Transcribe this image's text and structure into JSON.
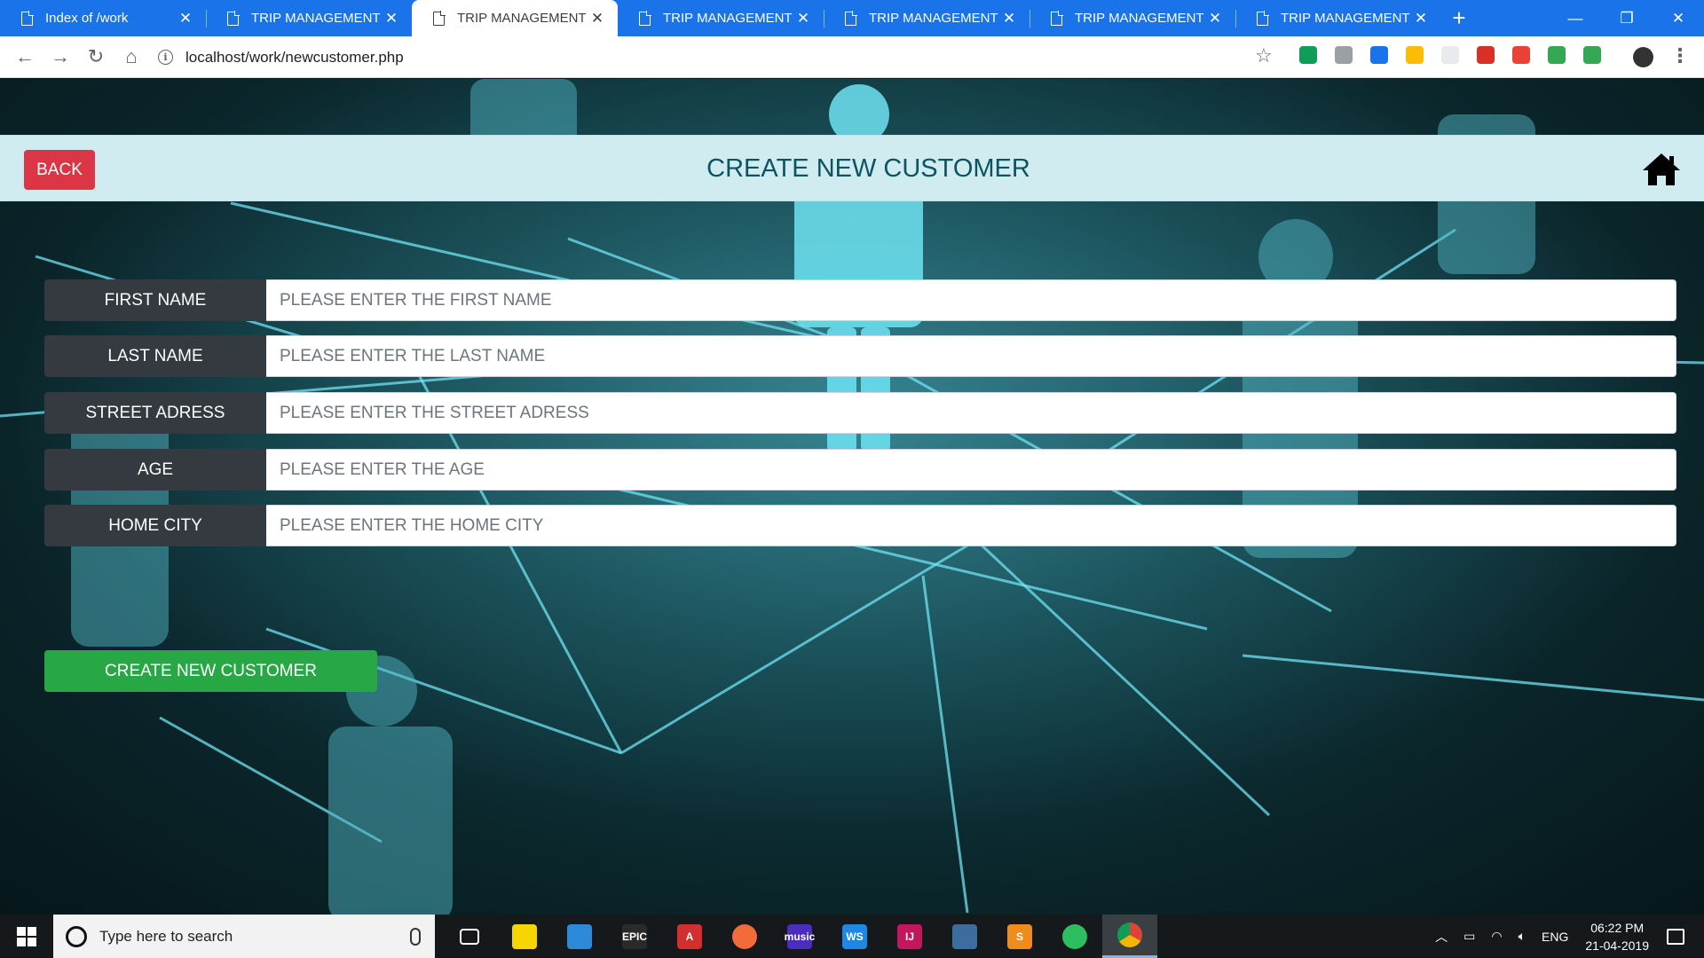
{
  "browser": {
    "tabs": [
      {
        "title": "Index of /work",
        "active": false
      },
      {
        "title": "TRIP MANAGEMENT",
        "active": false
      },
      {
        "title": "TRIP MANAGEMENT",
        "active": true
      },
      {
        "title": "TRIP MANAGEMENT",
        "active": false
      },
      {
        "title": "TRIP MANAGEMENT",
        "active": false
      },
      {
        "title": "TRIP MANAGEMENT",
        "active": false
      },
      {
        "title": "TRIP MANAGEMENT",
        "active": false
      }
    ],
    "url": "localhost/work/newcustomer.php",
    "extensions": [
      "#0f9d58",
      "#9aa0a6",
      "#1a73e8",
      "#fbbc04",
      "#e8eaed",
      "#d93025",
      "#ea4335",
      "#34a853",
      "#34a853"
    ],
    "accent": "#1a73e8"
  },
  "header": {
    "back_label": "BACK",
    "title": "CREATE NEW CUSTOMER",
    "home_icon": "home-icon"
  },
  "form": {
    "fields": [
      {
        "label": "FIRST NAME",
        "placeholder": "PLEASE ENTER THE FIRST NAME",
        "value": ""
      },
      {
        "label": "LAST NAME",
        "placeholder": "PLEASE ENTER THE LAST NAME",
        "value": ""
      },
      {
        "label": "STREET ADRESS",
        "placeholder": "PLEASE ENTER THE STREET ADRESS",
        "value": ""
      },
      {
        "label": "AGE",
        "placeholder": "PLEASE ENTER THE AGE",
        "value": ""
      },
      {
        "label": "HOME CITY",
        "placeholder": "PLEASE ENTER THE HOME CITY",
        "value": ""
      }
    ],
    "submit_label": "CREATE NEW CUSTOMER"
  },
  "colors": {
    "back": "#dc3545",
    "header_bg": "#d1ecf1",
    "header_text": "#0c5460",
    "label_bg": "#343a40",
    "submit": "#28a745"
  },
  "taskbar": {
    "search_placeholder": "Type here to search",
    "apps": [
      {
        "name": "task-view",
        "color": "transparent",
        "text": ""
      },
      {
        "name": "sticky-notes",
        "color": "#f6d500",
        "text": ""
      },
      {
        "name": "file-explorer",
        "color": "#2d8ad8",
        "text": ""
      },
      {
        "name": "epic-games",
        "color": "#2a2a2a",
        "text": "EPIC"
      },
      {
        "name": "angular",
        "color": "#d32f2f",
        "text": "A"
      },
      {
        "name": "postman",
        "color": "#f26b3a",
        "text": ""
      },
      {
        "name": "amazon-music",
        "color": "#4a2dbf",
        "text": "music"
      },
      {
        "name": "webstorm",
        "color": "#1e88e5",
        "text": "WS"
      },
      {
        "name": "intellij",
        "color": "#c2185b",
        "text": "IJ"
      },
      {
        "name": "mysql-workbench",
        "color": "#3b6e9e",
        "text": ""
      },
      {
        "name": "sublime-text",
        "color": "#ef8c1c",
        "text": "S"
      },
      {
        "name": "evernote",
        "color": "#2dbe60",
        "text": ""
      },
      {
        "name": "chrome",
        "color": "#db4437",
        "text": ""
      }
    ],
    "language": "ENG",
    "time": "06:22 PM",
    "date": "21-04-2019"
  }
}
